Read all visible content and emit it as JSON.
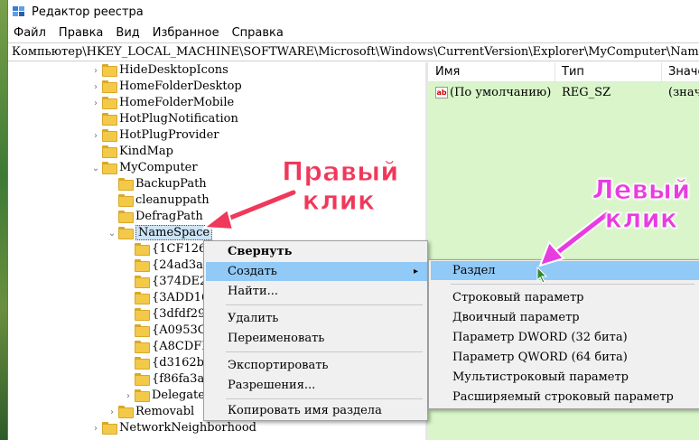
{
  "window": {
    "title": "Редактор реестра"
  },
  "menubar": {
    "items": [
      "Файл",
      "Правка",
      "Вид",
      "Избранное",
      "Справка"
    ]
  },
  "address": {
    "path": "Компьютер\\HKEY_LOCAL_MACHINE\\SOFTWARE\\Microsoft\\Windows\\CurrentVersion\\Explorer\\MyComputer\\NameSpace"
  },
  "tree": {
    "items": [
      {
        "label": "HideDesktopIcons",
        "expander": ">"
      },
      {
        "label": "HomeFolderDesktop",
        "expander": ">"
      },
      {
        "label": "HomeFolderMobile",
        "expander": ">"
      },
      {
        "label": "HotPlugNotification",
        "expander": ""
      },
      {
        "label": "HotPlugProvider",
        "expander": ">"
      },
      {
        "label": "KindMap",
        "expander": ""
      },
      {
        "label": "MyComputer",
        "expander": "v"
      },
      {
        "label": "BackupPath",
        "expander": ""
      },
      {
        "label": "cleanuppath",
        "expander": ""
      },
      {
        "label": "DefragPath",
        "expander": ""
      },
      {
        "label": "NameSpace",
        "expander": "v"
      },
      {
        "label": "{1CF126",
        "expander": ""
      },
      {
        "label": "{24ad3a",
        "expander": ""
      },
      {
        "label": "{374DE2",
        "expander": ""
      },
      {
        "label": "{3ADD16",
        "expander": ""
      },
      {
        "label": "{3dfdf29",
        "expander": ""
      },
      {
        "label": "{A0953C",
        "expander": ""
      },
      {
        "label": "{A8CDFI",
        "expander": ""
      },
      {
        "label": "{d3162b",
        "expander": ""
      },
      {
        "label": "{f86fa3a",
        "expander": ""
      },
      {
        "label": "Delegate",
        "expander": ">"
      },
      {
        "label": "Removabl",
        "expander": ">"
      },
      {
        "label": "NetworkNeighborhood",
        "expander": ">"
      }
    ]
  },
  "values": {
    "columns": [
      "Имя",
      "Тип",
      "Значе"
    ],
    "rows": [
      {
        "name": "(По умолчанию)",
        "type": "REG_SZ",
        "data": "(знач"
      }
    ]
  },
  "context_menu": {
    "items": [
      "Свернуть",
      "Создать",
      "Найти...",
      "Удалить",
      "Переименовать",
      "Экспортировать",
      "Разрешения...",
      "Копировать имя раздела"
    ]
  },
  "submenu": {
    "items": [
      "Раздел",
      "Строковый параметр",
      "Двоичный параметр",
      "Параметр DWORD (32 бита)",
      "Параметр QWORD (64 бита)",
      "Мультистроковый параметр",
      "Расширяемый строковый параметр"
    ]
  },
  "annotations": {
    "right_click": [
      "Правый",
      "клик"
    ],
    "left_click": [
      "Левый",
      "клик"
    ]
  },
  "colors": {
    "right_annotation": "#f0385a",
    "left_annotation": "#e83ce0",
    "menu_highlight": "#91c9f7",
    "values_background": "#d9f5c9"
  }
}
